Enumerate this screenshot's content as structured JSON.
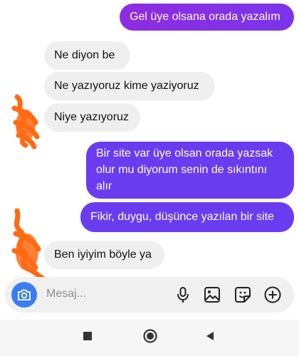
{
  "messages": [
    {
      "side": "out",
      "text": "Gel üye olsana orada yazalım"
    },
    {
      "side": "in",
      "text": "Ne diyon  be"
    },
    {
      "side": "in",
      "text": "Ne yazıyoruz kime yaziyoruz"
    },
    {
      "side": "in",
      "text": "Niye yazıyoruz"
    },
    {
      "side": "out",
      "text": "Bir site var üye olsan orada yazsak olur mu diyorum senin de sıkıntını alır"
    },
    {
      "side": "out",
      "text": "Fikir, duygu, düşünce yazılan bir site"
    },
    {
      "side": "in",
      "text": "Ben iyiyim böyle ya"
    }
  ],
  "composer": {
    "placeholder": "Mesaj...",
    "icons": [
      "camera-icon",
      "microphone-icon",
      "gallery-icon",
      "sticker-icon",
      "plus-icon"
    ]
  },
  "navbar": {
    "icons": [
      "recents-square-icon",
      "home-circle-icon",
      "back-triangle-icon"
    ]
  },
  "colors": {
    "outgoing_primary": "#7b35ea",
    "outgoing_secondary": "#6a3cf0",
    "incoming": "#efefef",
    "camera_button": "#3b7cf0",
    "scribble": "#ff6a13"
  }
}
